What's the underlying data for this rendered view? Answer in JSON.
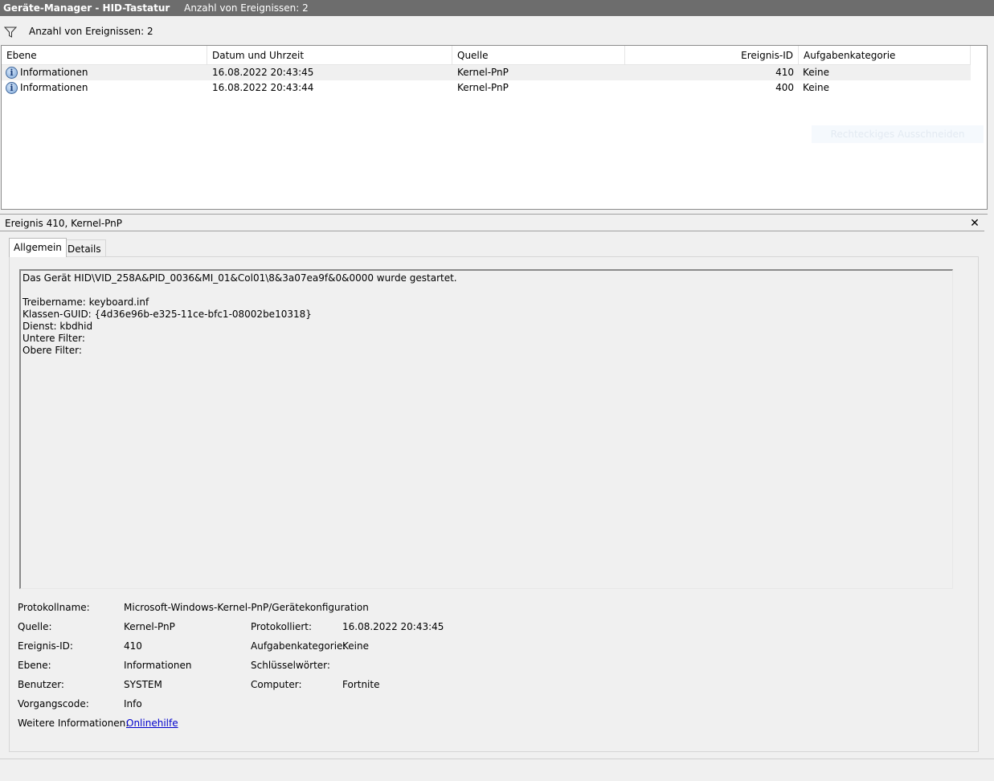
{
  "window": {
    "title": "Geräte-Manager - HID-Tastatur",
    "event_count_label": "Anzahl von Ereignissen: 2"
  },
  "filter_bar": {
    "icon": "filter-icon",
    "text": "Anzahl von Ereignissen: 2"
  },
  "event_list": {
    "columns": [
      "Ebene",
      "Datum und Uhrzeit",
      "Quelle",
      "Ereignis-ID",
      "Aufgabenkategorie"
    ],
    "rows": [
      {
        "icon": "info-icon",
        "level": "Informationen",
        "datetime": "16.08.2022 20:43:45",
        "source": "Kernel-PnP",
        "event_id": "410",
        "task_category": "Keine",
        "selected": true
      },
      {
        "icon": "info-icon",
        "level": "Informationen",
        "datetime": "16.08.2022 20:43:44",
        "source": "Kernel-PnP",
        "event_id": "400",
        "task_category": "Keine",
        "selected": false
      }
    ],
    "ghost_button": "Rechteckiges Ausschneiden"
  },
  "detail": {
    "title": "Ereignis 410, Kernel-PnP",
    "close_icon": "close-icon",
    "tabs": [
      {
        "label": "Allgemein",
        "active": true
      },
      {
        "label": "Details",
        "active": false
      }
    ],
    "description_lines": [
      "Das Gerät HID\\VID_258A&PID_0036&MI_01&Col01\\8&3a07ea9f&0&0000 wurde gestartet.",
      "",
      "Treibername: keyboard.inf",
      "Klassen-GUID: {4d36e96b-e325-11ce-bfc1-08002be10318}",
      "Dienst: kbdhid",
      "Untere Filter:",
      "Obere Filter:"
    ],
    "properties": {
      "protokollname_label": "Protokollname:",
      "protokollname_value": "Microsoft-Windows-Kernel-PnP/Gerätekonfiguration",
      "quelle_label": "Quelle:",
      "quelle_value": "Kernel-PnP",
      "protokolliert_label": "Protokolliert:",
      "protokolliert_value": "16.08.2022 20:43:45",
      "ereignis_id_label": "Ereignis-ID:",
      "ereignis_id_value": "410",
      "aufgabenkategorie_label": "Aufgabenkategorie:",
      "aufgabenkategorie_value": "Keine",
      "ebene_label": "Ebene:",
      "ebene_value": "Informationen",
      "schluesselwoerter_label": "Schlüsselwörter:",
      "schluesselwoerter_value": "",
      "benutzer_label": "Benutzer:",
      "benutzer_value": "SYSTEM",
      "computer_label": "Computer:",
      "computer_value": "Fortnite",
      "vorgangscode_label": "Vorgangscode:",
      "vorgangscode_value": "Info",
      "weitere_label": "Weitere Informationen:",
      "weitere_link": "Onlinehilfe"
    }
  },
  "colors": {
    "titlebar_bg": "#6d6d6d",
    "panel_bg": "#f0f0f0",
    "link": "#0000cc",
    "selected_row": "#f0f0f0"
  }
}
